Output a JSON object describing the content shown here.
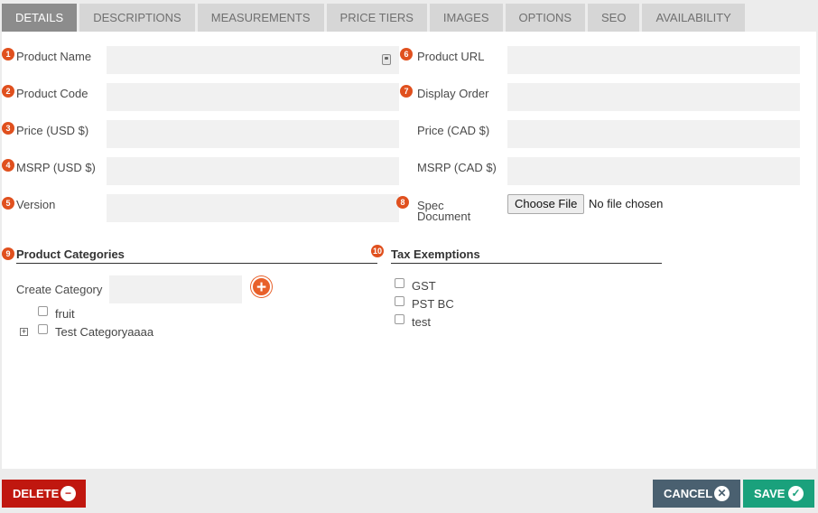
{
  "tabs": [
    {
      "label": "Details",
      "active": true
    },
    {
      "label": "Descriptions",
      "active": false
    },
    {
      "label": "Measurements",
      "active": false
    },
    {
      "label": "Price Tiers",
      "active": false
    },
    {
      "label": "Images",
      "active": false
    },
    {
      "label": "Options",
      "active": false
    },
    {
      "label": "SEO",
      "active": false
    },
    {
      "label": "Availability",
      "active": false
    }
  ],
  "fields": {
    "product_name": {
      "num": "1",
      "label": "Product Name",
      "value": ""
    },
    "product_code": {
      "num": "2",
      "label": "Product Code",
      "value": ""
    },
    "price_usd": {
      "num": "3",
      "label": "Price (USD $)",
      "value": ""
    },
    "msrp_usd": {
      "num": "4",
      "label": "MSRP (USD $)",
      "value": ""
    },
    "version": {
      "num": "5",
      "label": "Version",
      "value": ""
    },
    "product_url": {
      "num": "6",
      "label": "Product URL",
      "value": ""
    },
    "display_order": {
      "num": "7",
      "label": "Display Order",
      "value": ""
    },
    "price_cad": {
      "label": "Price (CAD $)",
      "value": ""
    },
    "msrp_cad": {
      "label": "MSRP (CAD $)",
      "value": ""
    },
    "spec_document": {
      "num": "8",
      "label_line1": "Spec",
      "label_line2": "Document",
      "button": "Choose File",
      "status": "No file chosen"
    }
  },
  "categories": {
    "num": "9",
    "title": "Product Categories",
    "create_label": "Create Category",
    "create_value": "",
    "items": [
      {
        "label": "fruit",
        "checked": false,
        "expandable": false
      },
      {
        "label": "Test Categoryaaaa",
        "checked": false,
        "expandable": true
      }
    ]
  },
  "tax": {
    "num": "10",
    "title": "Tax Exemptions",
    "items": [
      {
        "label": "GST",
        "checked": false
      },
      {
        "label": "PST BC",
        "checked": false
      },
      {
        "label": "test",
        "checked": false
      }
    ]
  },
  "actions": {
    "delete": "DELETE",
    "cancel": "CANCEL",
    "save": "SAVE"
  },
  "colors": {
    "accent": "#e0501e",
    "delete": "#c0170f",
    "cancel": "#4a6070",
    "save": "#1aa17c"
  }
}
